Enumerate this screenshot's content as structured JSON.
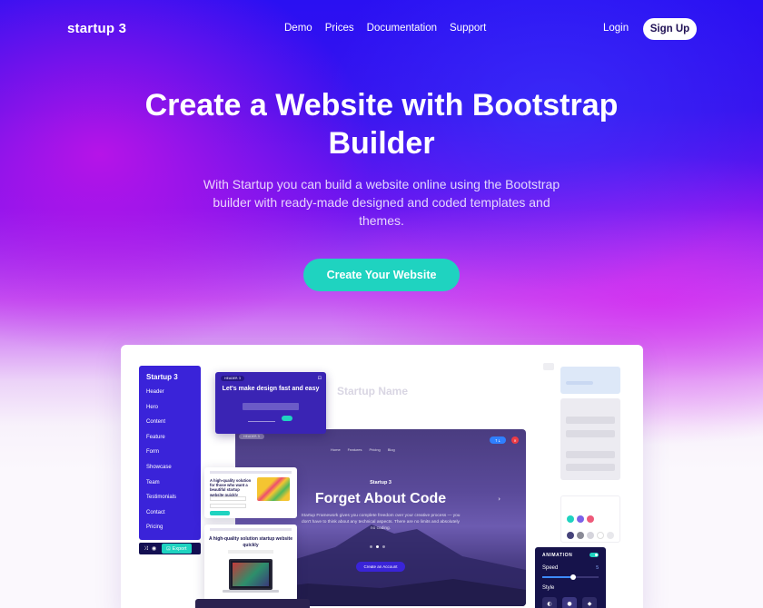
{
  "nav": {
    "logo": "startup 3",
    "links": [
      "Demo",
      "Prices",
      "Documentation",
      "Support"
    ],
    "login": "Login",
    "signup": "Sign Up"
  },
  "hero": {
    "title": "Create a Website with Bootstrap Builder",
    "subtitle": "With Startup you can build a website online using the Bootstrap builder with ready-made designed and coded templates and themes.",
    "cta": "Create Your Website"
  },
  "mockup": {
    "sidebar": {
      "title": "Startup 3",
      "items": [
        "Header",
        "Hero",
        "Content",
        "Feature",
        "Form",
        "Showcase",
        "Team",
        "Testimonials",
        "Contact",
        "Pricing"
      ],
      "export_label": "Export"
    },
    "faded_title": "Startup Name",
    "header_card": {
      "label": "HEADER 3",
      "title": "Let's make design fast and easy"
    },
    "main_preview": {
      "label": "HEADER 5",
      "nav": [
        "Home",
        "Features",
        "Pricing",
        "Blog"
      ],
      "small_title": "Startup 3",
      "title": "Forget About Code",
      "text": "Startup Framework gives you complete freedom over your creative process — you don't have to think about any technical aspects. There are no limits and absolutely no coding.",
      "button": "Create an Account"
    },
    "feature_card_1": {
      "title": "A high-quality solution for those who want a beautiful startup website quickly"
    },
    "feature_card_2": {
      "title": "A high-quality solution startup website quickly"
    },
    "animation_panel": {
      "title": "ANIMATION",
      "speed_label": "Speed",
      "speed_value": "5",
      "speed_fraction": 0.55,
      "style_label": "Style"
    },
    "colors": {
      "brand_blue": "#3a23d9",
      "teal": "#1fd3c0",
      "swatch_row1": [
        "#1fd3c0",
        "#7b61e8",
        "#ee5a7a"
      ],
      "swatch_row2": [
        "#45427a",
        "#8a8a96",
        "#d5d4dc",
        "#ffffff",
        "#e8e8ec"
      ]
    }
  }
}
